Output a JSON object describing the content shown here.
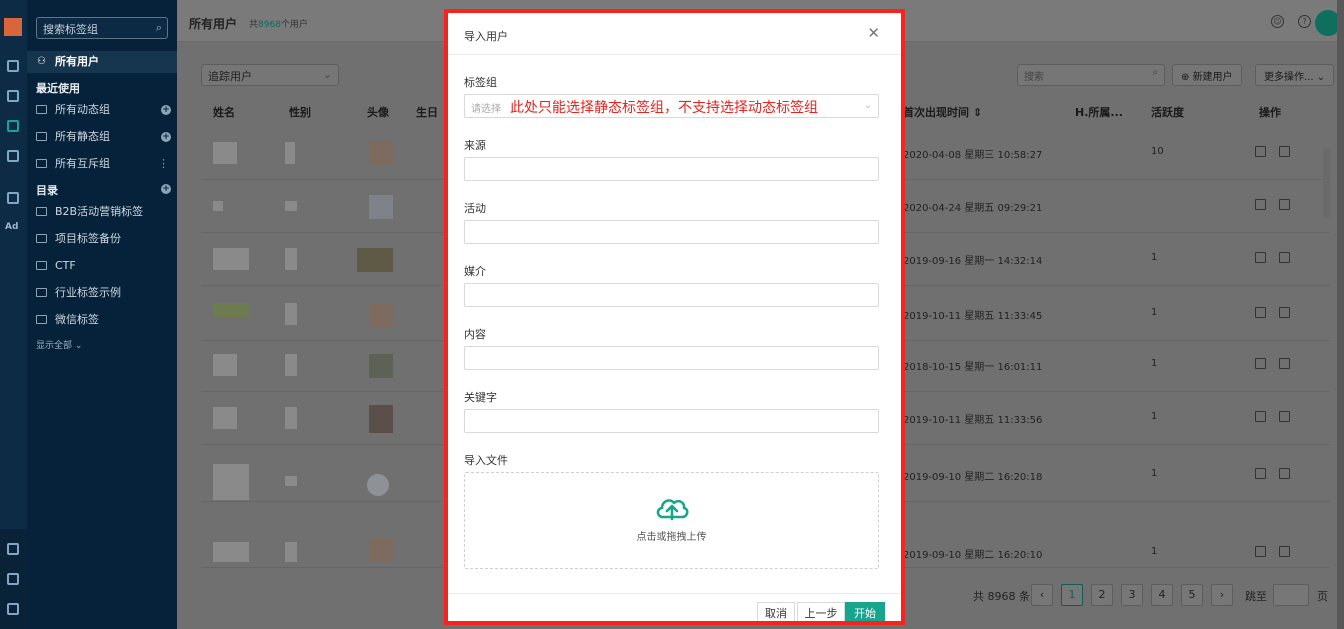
{
  "sidebar": {
    "search_placeholder": "搜索标签组",
    "all_users": "所有用户",
    "recent_heading": "最近使用",
    "groups": [
      "所有动态组",
      "所有静态组",
      "所有互斥组"
    ],
    "catalog_heading": "目录",
    "folders": [
      "B2B活动营销标签",
      "项目标签备份",
      "CTF",
      "行业标签示例",
      "微信标签"
    ],
    "show_all": "显示全部"
  },
  "rail": {
    "ad_label": "Ad"
  },
  "main": {
    "title": "所有用户",
    "count_prefix": "共",
    "count_value": "8968",
    "count_suffix": "个用户",
    "filter_select": "追踪用户",
    "search_placeholder": "搜索",
    "new_user_button": "新建用户",
    "more_button": "更多操作...",
    "columns": [
      "姓名",
      "性别",
      "头像",
      "生日",
      "首次出现时间",
      "H.所属...",
      "活跃度",
      "操作"
    ],
    "rows": [
      {
        "first_seen": "2020-04-08 星期三 10:58:27",
        "activity": "10"
      },
      {
        "first_seen": "2020-04-24 星期五 09:29:21",
        "activity": ""
      },
      {
        "first_seen": "2019-09-16 星期一 14:32:14",
        "activity": "1"
      },
      {
        "first_seen": "2019-10-11 星期五 11:33:45",
        "activity": "1"
      },
      {
        "first_seen": "2018-10-15 星期一 16:01:11",
        "activity": "1"
      },
      {
        "first_seen": "2019-10-11 星期五 11:33:56",
        "activity": "1"
      },
      {
        "first_seen": "2019-09-10 星期二 16:20:18",
        "activity": "1"
      },
      {
        "first_seen": "2019-09-10 星期二 16:20:10",
        "activity": "1"
      }
    ],
    "pagination": {
      "total": "共 8968 条",
      "pages": [
        "1",
        "2",
        "3",
        "4",
        "5"
      ],
      "goto": "跳至",
      "page_unit": "页"
    }
  },
  "modal": {
    "title": "导入用户",
    "fields": {
      "tag_group": "标签组",
      "tag_group_placeholder": "请选择",
      "tag_group_note": "此处只能选择静态标签组，不支持选择动态标签组",
      "source": "来源",
      "campaign": "活动",
      "medium": "媒介",
      "content": "内容",
      "keyword": "关键字",
      "import_file": "导入文件"
    },
    "upload_text": "点击或拖拽上传",
    "buttons": {
      "cancel": "取消",
      "prev": "上一步",
      "start": "开始"
    }
  },
  "colors": {
    "accent": "#17a58e",
    "highlight": "#f7231f",
    "sidebar_bg": "#06223b"
  }
}
